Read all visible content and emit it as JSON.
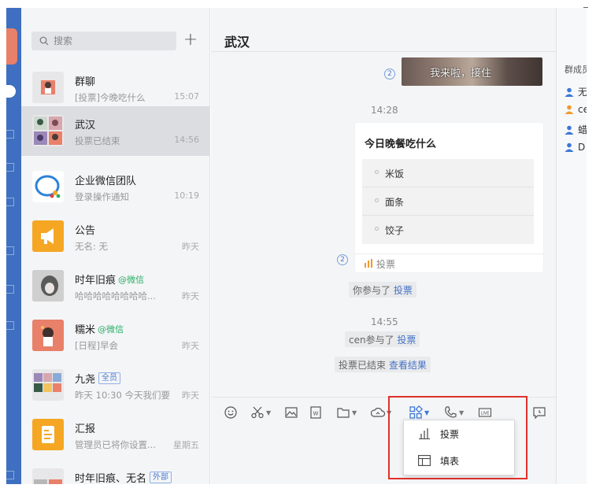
{
  "search": {
    "placeholder": "搜索"
  },
  "add_button": "+",
  "conversations": [
    {
      "title": "群聊",
      "subtitle": "[投票]今晚吃什么",
      "time": "15:07"
    },
    {
      "title": "武汉",
      "subtitle": "投票已结束",
      "time": "14:56",
      "selected": true
    },
    {
      "title": "企业微信团队",
      "subtitle": "登录操作通知",
      "time": "10:19"
    },
    {
      "title": "公告",
      "subtitle": "无名: 无",
      "time": "昨天"
    },
    {
      "title": "时年旧痕",
      "tag": "@微信",
      "subtitle": "哈哈哈哈哈哈哈哈...",
      "time": "昨天"
    },
    {
      "title": "糯米",
      "tag": "@微信",
      "subtitle": "[日程]早会",
      "time": "昨天"
    },
    {
      "title": "九尧",
      "badge": "全员",
      "subtitle": "昨天 10:30 今天我们要",
      "time": "昨天"
    },
    {
      "title": "汇报",
      "subtitle": "管理员已将你设置...",
      "time": "星期五"
    },
    {
      "title": "时年旧痕、无名",
      "badge": "外部",
      "subtitle": "",
      "time": ""
    }
  ],
  "chat": {
    "title": "武汉",
    "image_caption": "我来啦，接住",
    "read_count_1": "2",
    "timestamp_1": "14:28",
    "poll": {
      "title": "今日晚餐吃什么",
      "options": [
        "米饭",
        "面条",
        "饺子"
      ],
      "footer_label": "投票"
    },
    "read_count_2": "2",
    "sys_1": {
      "text": "你参与了",
      "link": "投票"
    },
    "timestamp_2": "14:55",
    "sys_2": {
      "text": "cen参与了",
      "link": "投票"
    },
    "sys_3": {
      "text": "投票已结束",
      "link": "查看结果"
    }
  },
  "toolbar": {
    "icons": [
      "emoji-icon",
      "scissors-icon",
      "image-icon",
      "word-icon",
      "folder-icon",
      "cloud-icon",
      "apps-icon",
      "phone-icon",
      "live-icon",
      "message-icon"
    ]
  },
  "dropdown": {
    "items": [
      {
        "label": "投票",
        "icon": "bar-chart-icon"
      },
      {
        "label": "填表",
        "icon": "table-icon"
      }
    ]
  },
  "members": {
    "header": "群成员",
    "items": [
      {
        "name": "无",
        "color": "#3b78d6"
      },
      {
        "name": "cen",
        "color": "#f09a2e"
      },
      {
        "name": "蜡",
        "color": "#3b78d6"
      },
      {
        "name": "D",
        "color": "#3b78d6"
      }
    ]
  },
  "colors": {
    "accent": "#3e6fc0",
    "highlight": "#e0312b",
    "link": "#4673c6",
    "wechat_tag": "#2aae67"
  }
}
